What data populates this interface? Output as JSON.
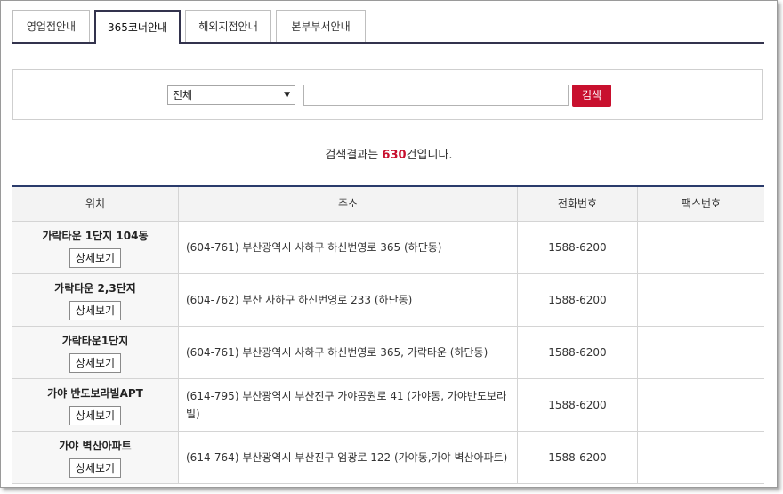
{
  "tabs": [
    {
      "label": "영업점안내",
      "active": false
    },
    {
      "label": "365코너안내",
      "active": true
    },
    {
      "label": "해외지점안내",
      "active": false
    },
    {
      "label": "본부부서안내",
      "active": false
    }
  ],
  "search": {
    "select_value": "전체",
    "input_value": "",
    "button_label": "검색"
  },
  "result": {
    "prefix": "검색결과는 ",
    "count": "630",
    "suffix": "건입니다."
  },
  "table": {
    "headers": [
      "위치",
      "주소",
      "전화번호",
      "팩스번호"
    ],
    "rows": [
      {
        "name": "가락타운 1단지 104동",
        "detail_label": "상세보기",
        "address": "(604-761) 부산광역시 사하구 하신번영로 365 (하단동)",
        "phone": "1588-6200",
        "fax": ""
      },
      {
        "name": "가락타운 2,3단지",
        "detail_label": "상세보기",
        "address": "(604-762) 부산 사하구 하신번영로 233 (하단동)",
        "phone": "1588-6200",
        "fax": ""
      },
      {
        "name": "가락타운1단지",
        "detail_label": "상세보기",
        "address": "(604-761) 부산광역시 사하구 하신번영로 365, 가락타운 (하단동)",
        "phone": "1588-6200",
        "fax": ""
      },
      {
        "name": "가야 반도보라빌APT",
        "detail_label": "상세보기",
        "address": "(614-795) 부산광역시 부산진구 가야공원로 41 (가야동, 가야반도보라빌)",
        "phone": "1588-6200",
        "fax": ""
      },
      {
        "name": "가야 벽산아파트",
        "detail_label": "상세보기",
        "address": "(614-764) 부산광역시 부산진구 엄광로 122 (가야동,가야 벽산아파트)",
        "phone": "1588-6200",
        "fax": ""
      }
    ]
  },
  "colors": {
    "accent": "#c8102e",
    "header_line": "#2a3b6b",
    "tab_border": "#33334d"
  },
  "icons": {
    "select_arrow": "chevron-down-icon"
  }
}
